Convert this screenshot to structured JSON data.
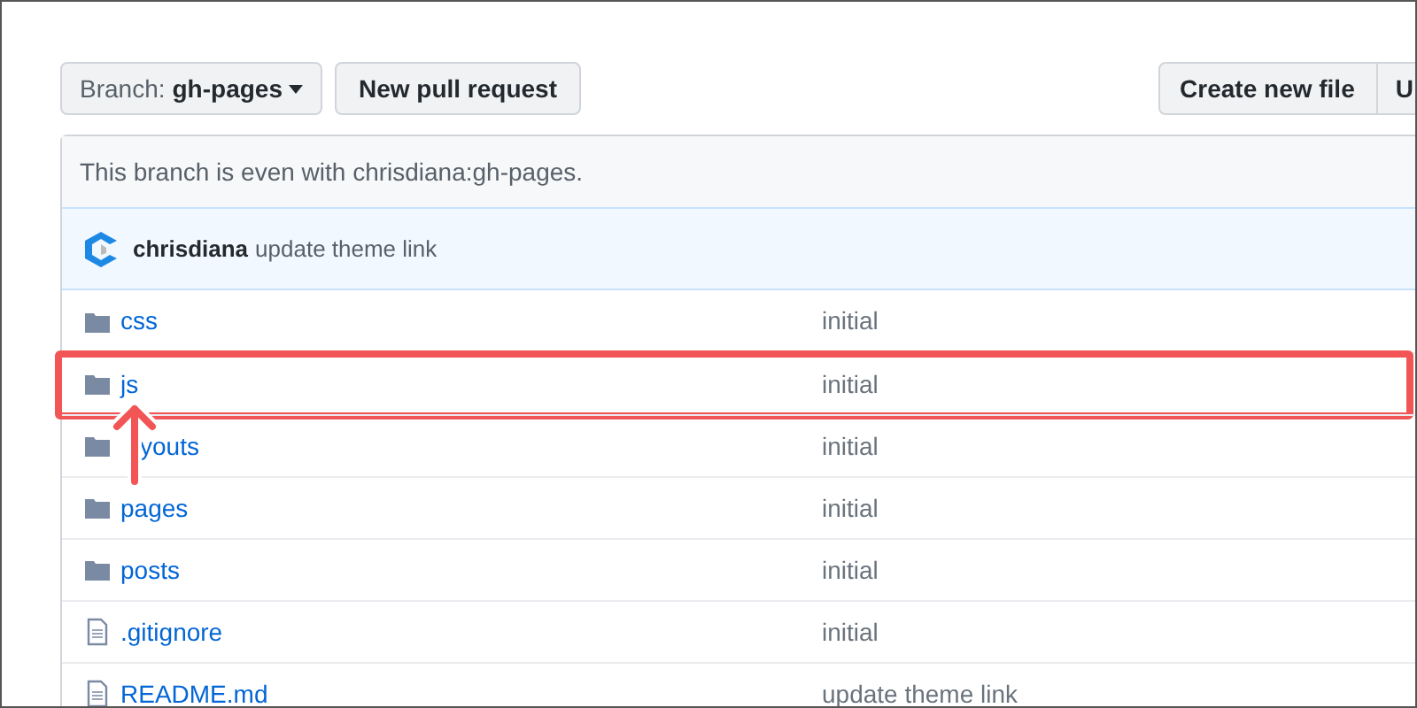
{
  "toolbar": {
    "branch_label": "Branch:",
    "branch_name": "gh-pages",
    "left_buttons": [
      "New pull request"
    ],
    "right_buttons": [
      "Create new file",
      "U"
    ]
  },
  "branch_status": "This branch is even with chrisdiana:gh-pages.",
  "latest_commit": {
    "author": "chrisdiana",
    "message": "update theme link"
  },
  "files": [
    {
      "kind": "folder",
      "name": "css",
      "message": "initial",
      "highlighted": false
    },
    {
      "kind": "folder",
      "name": "js",
      "message": "initial",
      "highlighted": true
    },
    {
      "kind": "folder",
      "name": "youts",
      "message": "initial",
      "highlighted": false
    },
    {
      "kind": "folder",
      "name": "pages",
      "message": "initial",
      "highlighted": false
    },
    {
      "kind": "folder",
      "name": "posts",
      "message": "initial",
      "highlighted": false
    },
    {
      "kind": "file",
      "name": ".gitignore",
      "message": "initial",
      "highlighted": false
    },
    {
      "kind": "file",
      "name": "README.md",
      "message": "update theme link",
      "highlighted": false
    }
  ]
}
